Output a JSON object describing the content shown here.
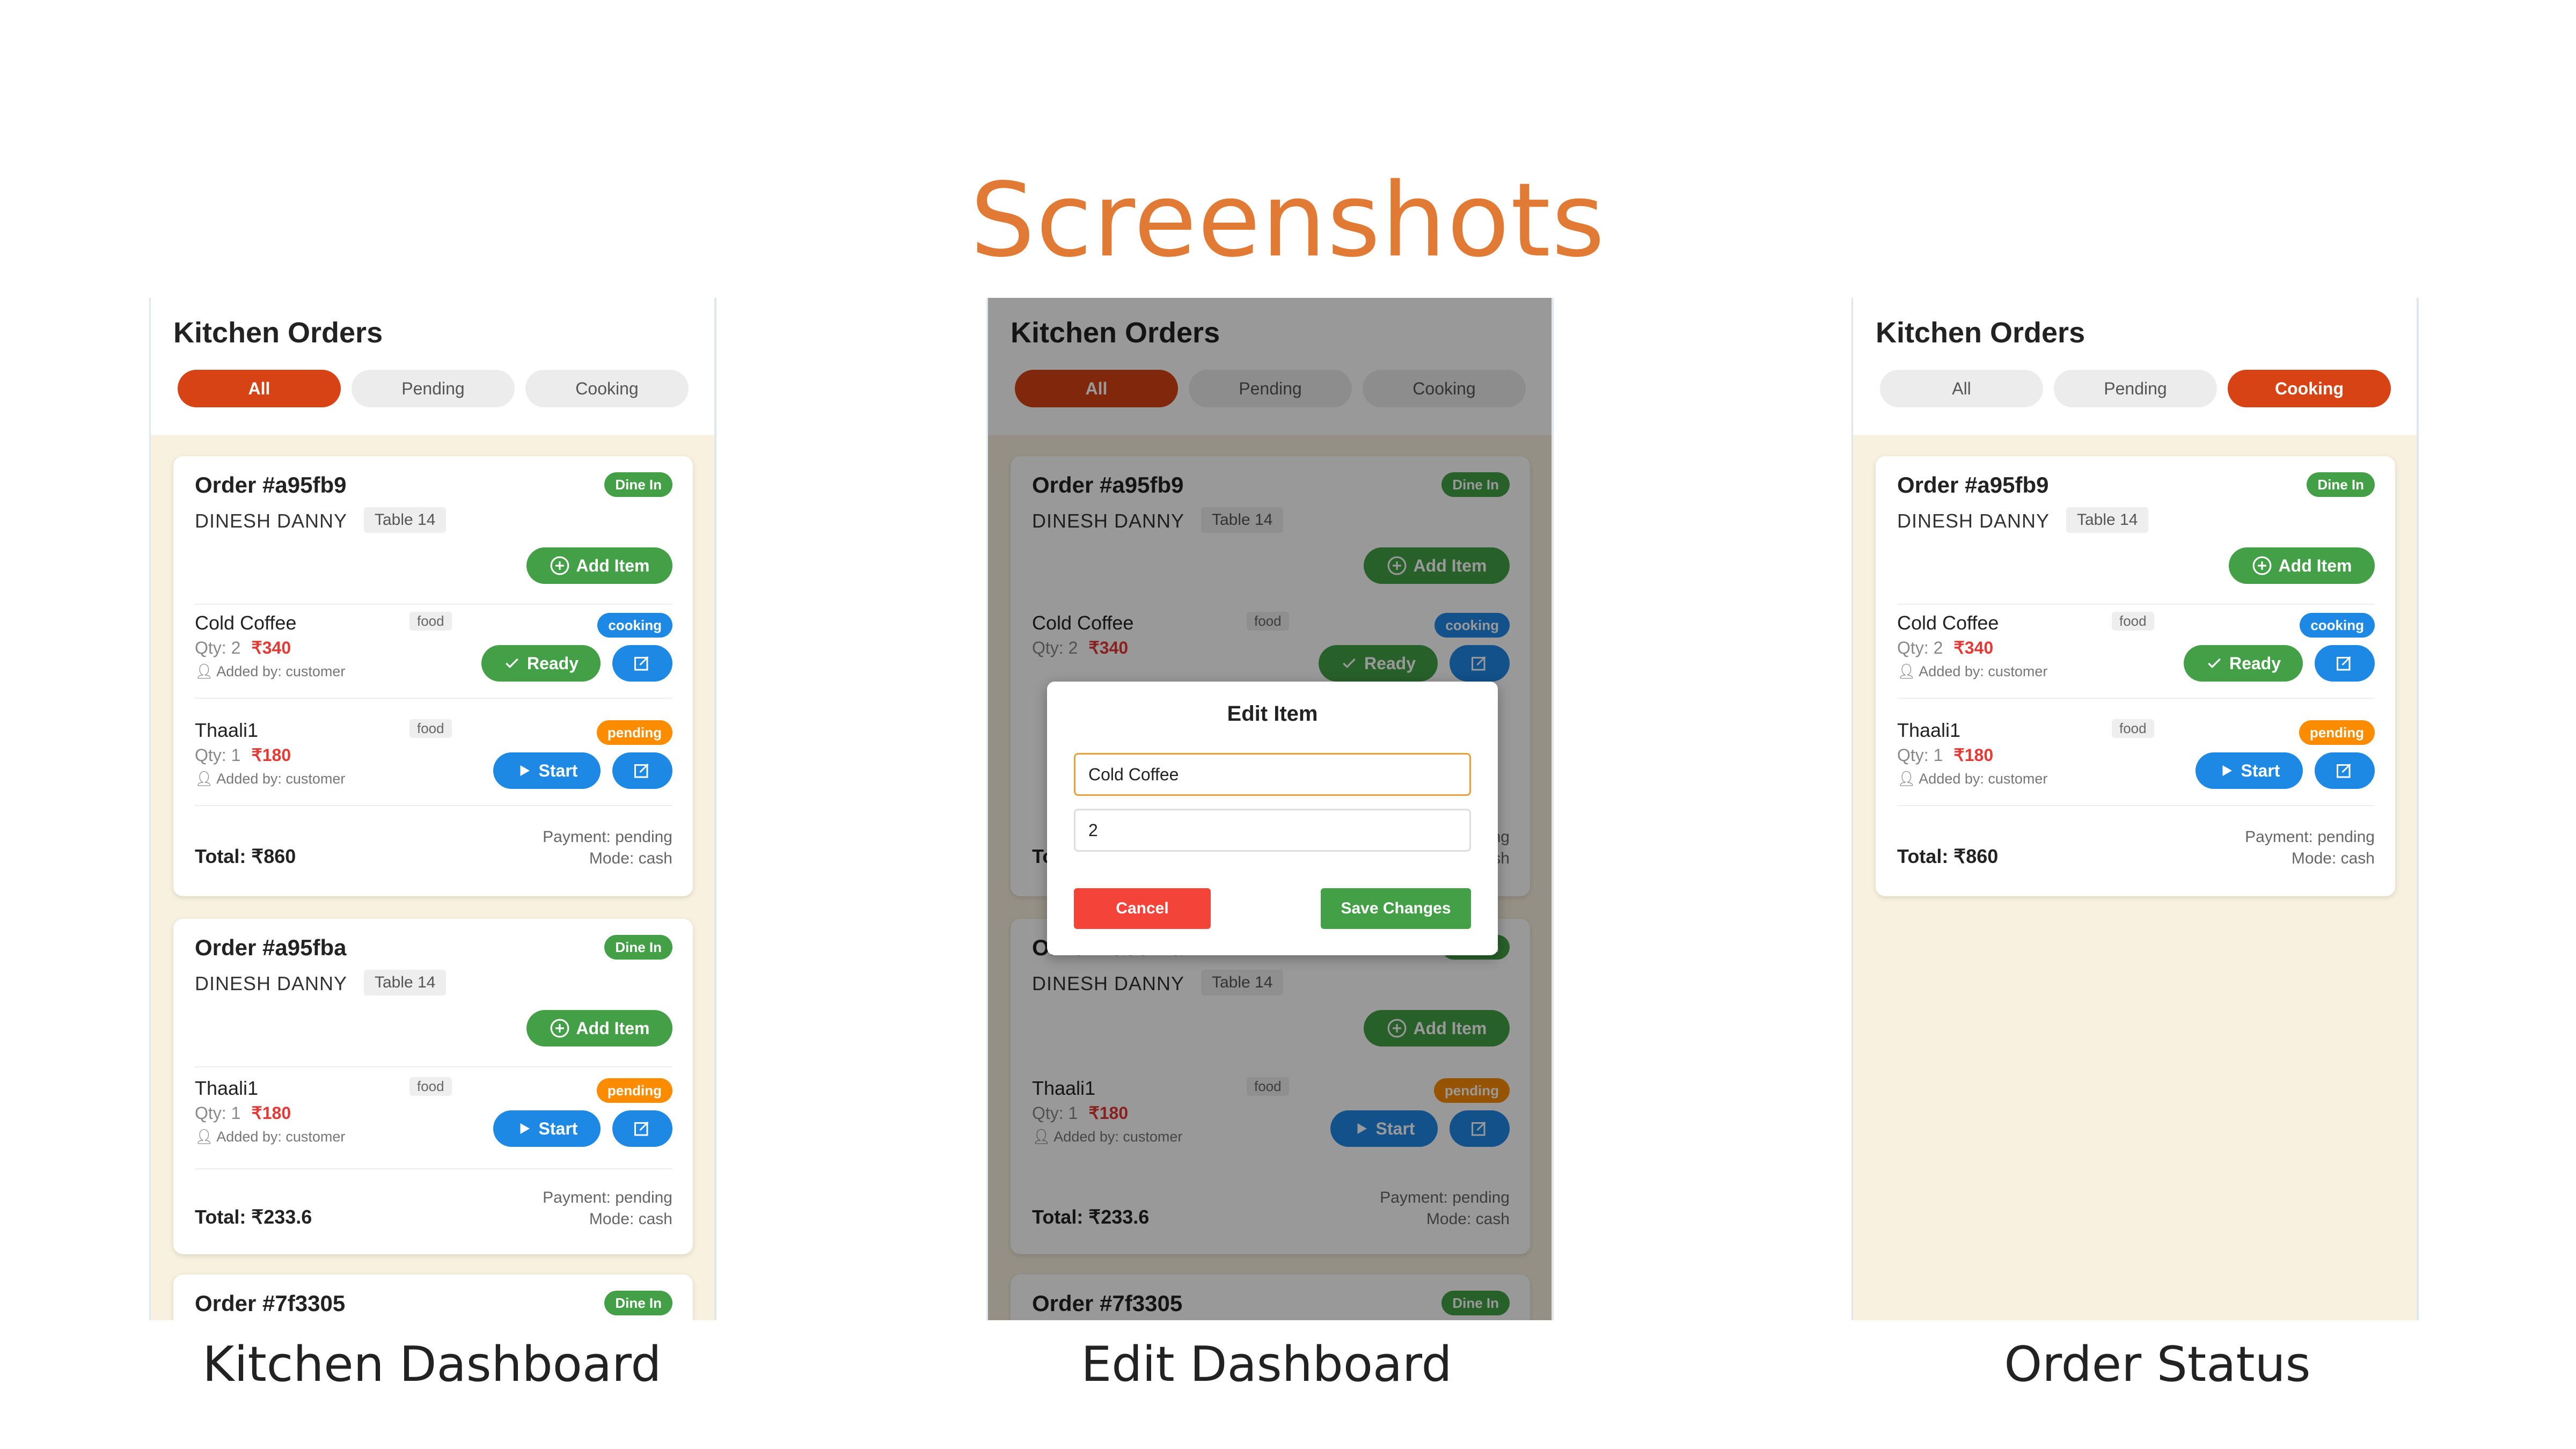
{
  "slide": {
    "title": "Screenshots",
    "captions": [
      "Kitchen Dashboard",
      "Edit Dashboard",
      "Order Status"
    ]
  },
  "app": {
    "title": "Kitchen Orders",
    "tabs": [
      "All",
      "Pending",
      "Cooking"
    ]
  },
  "orders": [
    {
      "id": "Order #a95fb9",
      "type": "Dine In",
      "customer": "DINESH DANNY",
      "table": "Table 14",
      "add_label": "Add Item",
      "items": [
        {
          "name": "Cold Coffee",
          "category": "food",
          "qty": "Qty: 2",
          "price": "₹340",
          "added_by": "Added by: customer",
          "status": "cooking",
          "action": "Ready"
        },
        {
          "name": "Thaali1",
          "category": "food",
          "qty": "Qty: 1",
          "price": "₹180",
          "added_by": "Added by: customer",
          "status": "pending",
          "action": "Start"
        }
      ],
      "total": "Total: ₹860",
      "payment": "Payment: pending",
      "mode": "Mode: cash"
    },
    {
      "id": "Order #a95fba",
      "type": "Dine In",
      "customer": "DINESH DANNY",
      "table": "Table 14",
      "add_label": "Add Item",
      "items": [
        {
          "name": "Thaali1",
          "category": "food",
          "qty": "Qty: 1",
          "price": "₹180",
          "added_by": "Added by: customer",
          "status": "pending",
          "action": "Start"
        }
      ],
      "total": "Total: ₹233.6",
      "payment": "Payment: pending",
      "mode": "Mode: cash"
    },
    {
      "id": "Order #7f3305",
      "type": "Dine In"
    }
  ],
  "modal": {
    "title": "Edit Item",
    "name_value": "Cold Coffee",
    "qty_value": "2",
    "cancel_label": "Cancel",
    "save_label": "Save Changes"
  },
  "colors": {
    "accent": "#d84315",
    "title_orange": "#e07a35",
    "green": "#43a047",
    "blue": "#1e88e5",
    "orange": "#fb8c00",
    "price_red": "#e53935",
    "panel_bg": "#f8f1df"
  },
  "icons": [
    "plus-circle-icon",
    "check-icon",
    "play-icon",
    "edit-icon",
    "user-icon"
  ]
}
